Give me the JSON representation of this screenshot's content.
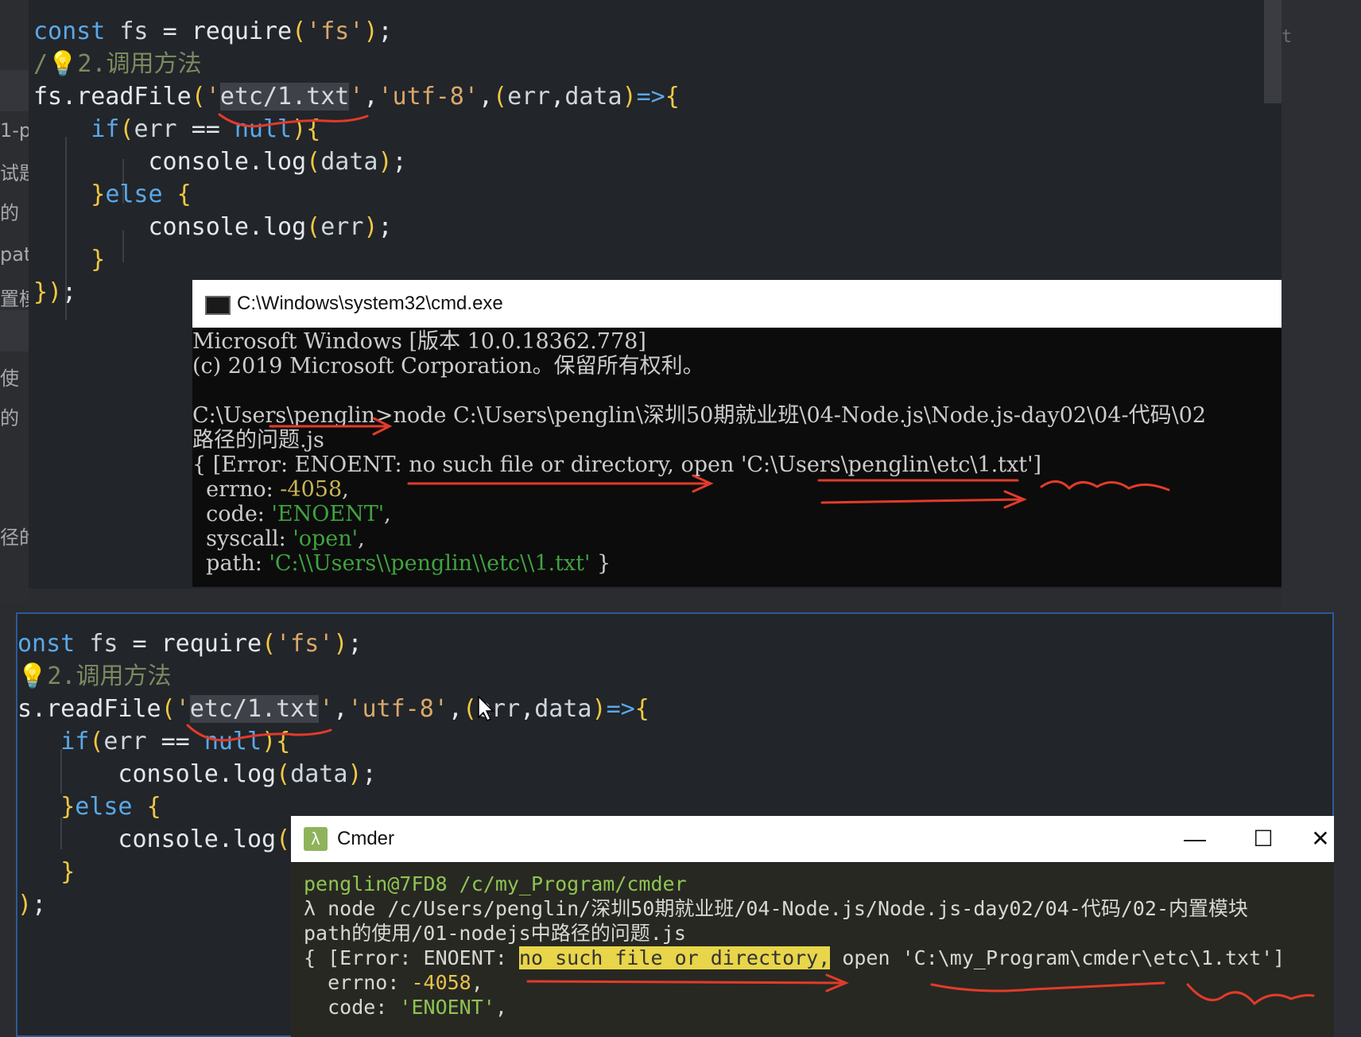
{
  "sidebar": {
    "fragments": [
      "1-p",
      "试题",
      "的",
      "pat",
      "置模",
      "使",
      "的",
      "径的"
    ]
  },
  "top_editor": {
    "lines": [
      {
        "parts": [
          [
            "kw",
            "const "
          ],
          [
            "cn",
            "fs "
          ],
          [
            "fn",
            "= "
          ],
          [
            "fn",
            "require"
          ],
          [
            "pn",
            "("
          ],
          [
            "str",
            "'fs'"
          ],
          [
            "pn",
            ")"
          ],
          [
            "fn",
            ";"
          ]
        ]
      },
      {
        "parts": [
          [
            "cm",
            "/"
          ],
          [
            "pn",
            "💡"
          ],
          [
            "cm",
            "2.调用方法"
          ]
        ]
      },
      {
        "parts": [
          [
            "fn",
            "fs.readFile"
          ],
          [
            "pn",
            "("
          ],
          [
            "str",
            "'"
          ],
          [
            "sel",
            "etc/1.txt"
          ],
          [
            "str",
            "'"
          ],
          [
            "fn",
            ","
          ],
          [
            "str",
            "'utf-8'"
          ],
          [
            "fn",
            ","
          ],
          [
            "pn",
            "("
          ],
          [
            "cn",
            "err"
          ],
          [
            "fn",
            ","
          ],
          [
            "cn",
            "data"
          ],
          [
            "pn",
            ")"
          ],
          [
            "kw",
            "=>"
          ],
          [
            "pn",
            "{"
          ]
        ]
      },
      {
        "parts": [
          [
            "fn",
            "    "
          ],
          [
            "kw",
            "if"
          ],
          [
            "pn",
            "("
          ],
          [
            "cn",
            "err "
          ],
          [
            "fn",
            "== "
          ],
          [
            "kw",
            "null"
          ],
          [
            "pn",
            ")"
          ],
          [
            "pn",
            "{"
          ]
        ]
      },
      {
        "parts": [
          [
            "fn",
            "        console.log"
          ],
          [
            "pn",
            "("
          ],
          [
            "cn",
            "data"
          ],
          [
            "pn",
            ")"
          ],
          [
            "fn",
            ";"
          ]
        ]
      },
      {
        "parts": [
          [
            "fn",
            "    "
          ],
          [
            "pn",
            "}"
          ],
          [
            "kw",
            "else "
          ],
          [
            "pn",
            "{"
          ]
        ]
      },
      {
        "parts": [
          [
            "fn",
            "        console.log"
          ],
          [
            "pn",
            "("
          ],
          [
            "cn",
            "err"
          ],
          [
            "pn",
            ")"
          ],
          [
            "fn",
            ";"
          ]
        ]
      },
      {
        "parts": [
          [
            "fn",
            "    "
          ],
          [
            "pn",
            "}"
          ]
        ]
      },
      {
        "parts": [
          [
            "pn",
            "})"
          ],
          [
            "fn",
            ";"
          ]
        ]
      }
    ]
  },
  "cmd_window": {
    "title": "C:\\Windows\\system32\\cmd.exe",
    "lines": [
      {
        "parts": [
          [
            "d",
            "Microsoft Windows [版本 10.0.18362.778]"
          ]
        ]
      },
      {
        "parts": [
          [
            "d",
            "(c) 2019 Microsoft Corporation。保留所有权利。"
          ]
        ]
      },
      {
        "parts": [
          [
            "d",
            ""
          ]
        ]
      },
      {
        "parts": [
          [
            "d",
            "C:\\Users\\penglin>node C:\\Users\\penglin\\深圳50期就业班\\04-Node.js\\Node.js-day02\\04-代码\\02"
          ]
        ]
      },
      {
        "parts": [
          [
            "d",
            "路径的问题.js"
          ]
        ]
      },
      {
        "parts": [
          [
            "d",
            "{ [Error: ENOENT: no such file or directory, open 'C:\\Users\\penglin\\etc\\1.txt']"
          ]
        ]
      },
      {
        "parts": [
          [
            "d",
            "  errno: "
          ],
          [
            "y",
            "-4058"
          ],
          [
            "d",
            ","
          ]
        ]
      },
      {
        "parts": [
          [
            "d",
            "  code: "
          ],
          [
            "g",
            "'ENOENT'"
          ],
          [
            "d",
            ","
          ]
        ]
      },
      {
        "parts": [
          [
            "d",
            "  syscall: "
          ],
          [
            "g",
            "'open'"
          ],
          [
            "d",
            ","
          ]
        ]
      },
      {
        "parts": [
          [
            "d",
            "  path: "
          ],
          [
            "g",
            "'C:\\\\Users\\\\penglin\\\\etc\\\\1.txt'"
          ],
          [
            "d",
            " }"
          ]
        ]
      }
    ]
  },
  "bottom_editor": {
    "lines": [
      {
        "parts": [
          [
            "kw",
            "onst "
          ],
          [
            "cn",
            "fs "
          ],
          [
            "fn",
            "= "
          ],
          [
            "fn",
            "require"
          ],
          [
            "pn",
            "("
          ],
          [
            "str",
            "'fs'"
          ],
          [
            "pn",
            ")"
          ],
          [
            "fn",
            ";"
          ]
        ]
      },
      {
        "parts": [
          [
            "pn",
            "💡"
          ],
          [
            "cm",
            "2.调用方法"
          ]
        ]
      },
      {
        "parts": [
          [
            "fn",
            "s.readFile"
          ],
          [
            "pn",
            "("
          ],
          [
            "str",
            "'"
          ],
          [
            "sel",
            "etc/1.txt"
          ],
          [
            "str",
            "'"
          ],
          [
            "fn",
            ","
          ],
          [
            "str",
            "'utf-8'"
          ],
          [
            "fn",
            ","
          ],
          [
            "pn",
            "("
          ],
          [
            "cn",
            "err"
          ],
          [
            "fn",
            ","
          ],
          [
            "cn",
            "data"
          ],
          [
            "pn",
            ")"
          ],
          [
            "kw",
            "=>"
          ],
          [
            "pn",
            "{"
          ]
        ]
      },
      {
        "parts": [
          [
            "fn",
            "   "
          ],
          [
            "kw",
            "if"
          ],
          [
            "pn",
            "("
          ],
          [
            "cn",
            "err "
          ],
          [
            "fn",
            "== "
          ],
          [
            "kw",
            "null"
          ],
          [
            "pn",
            ")"
          ],
          [
            "pn",
            "{"
          ]
        ]
      },
      {
        "parts": [
          [
            "fn",
            "       console.log"
          ],
          [
            "pn",
            "("
          ],
          [
            "cn",
            "data"
          ],
          [
            "pn",
            ")"
          ],
          [
            "fn",
            ";"
          ]
        ]
      },
      {
        "parts": [
          [
            "fn",
            "   "
          ],
          [
            "pn",
            "}"
          ],
          [
            "kw",
            "else "
          ],
          [
            "pn",
            "{"
          ]
        ]
      },
      {
        "parts": [
          [
            "fn",
            "       console.log"
          ],
          [
            "pn",
            "("
          ]
        ]
      },
      {
        "parts": [
          [
            "fn",
            "   "
          ],
          [
            "pn",
            "}"
          ]
        ]
      },
      {
        "parts": [
          [
            "pn",
            ")"
          ],
          [
            "fn",
            ";"
          ]
        ]
      }
    ]
  },
  "cmder_window": {
    "title": "Cmder",
    "icon": "λ",
    "minimize": "—",
    "maximize": "☐",
    "close": "✕",
    "lines": [
      {
        "parts": [
          [
            "g",
            "penglin@7FD8 /c/my_Program/cmder"
          ]
        ]
      },
      {
        "parts": [
          [
            "d",
            "λ node /c/Users/penglin/深圳50期就业班/04-Node.js/Node.js-day02/04-代码/02-内置模块"
          ]
        ]
      },
      {
        "parts": [
          [
            "d",
            "path的使用/01-nodejs中路径的问题.js"
          ]
        ]
      },
      {
        "parts": [
          [
            "d",
            "{ [Error: ENOENT: "
          ],
          [
            "h",
            "no such file or directory,"
          ],
          [
            "d",
            " open 'C:\\my_Program\\cmder\\etc\\1.txt']"
          ]
        ]
      },
      {
        "parts": [
          [
            "d",
            "  errno: "
          ],
          [
            "y",
            "-4058"
          ],
          [
            "d",
            ","
          ]
        ]
      },
      {
        "parts": [
          [
            "d",
            "  code: "
          ],
          [
            "g",
            "'ENOENT'"
          ],
          [
            "d",
            ","
          ]
        ]
      }
    ]
  },
  "right_panel": {
    "fragment": "t"
  }
}
